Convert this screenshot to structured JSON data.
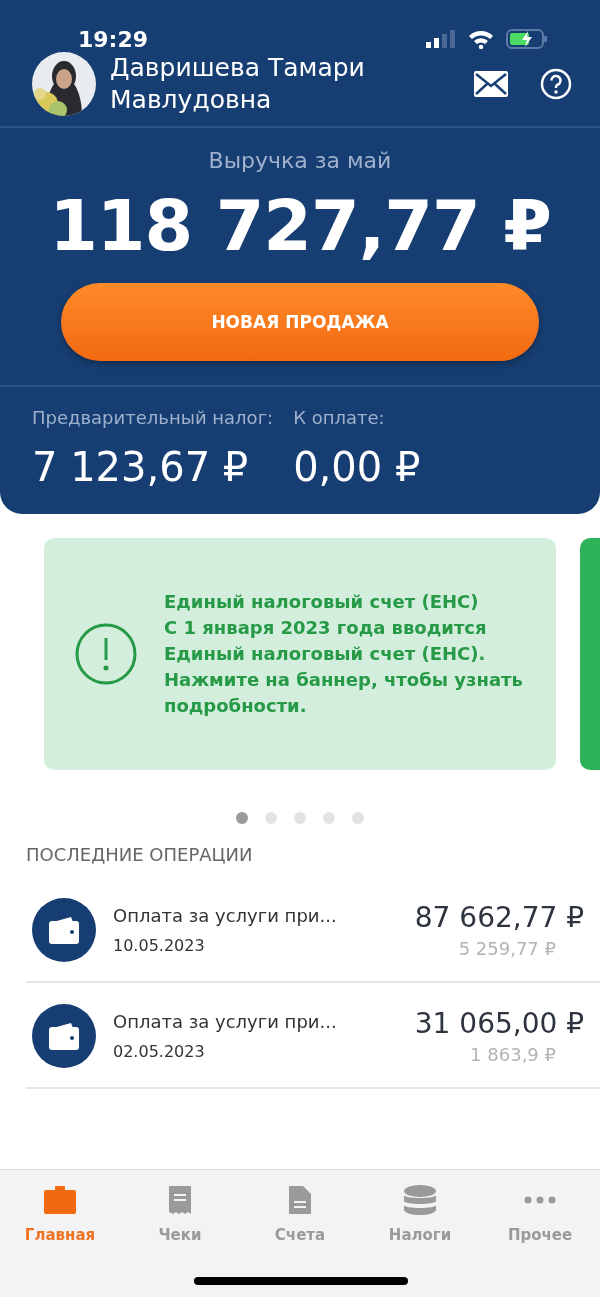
{
  "status_bar": {
    "time": "19:29"
  },
  "profile": {
    "name": "Давришева Тамари Мавлудовна"
  },
  "revenue": {
    "label": "Выручка за май",
    "amount": "118 727,77 ₽"
  },
  "new_sale_button": "НОВАЯ ПРОДАЖА",
  "taxes": [
    {
      "label": "Предварительный налог:",
      "value": "7 123,67 ₽"
    },
    {
      "label": "К оплате:",
      "value": "0,00 ₽"
    }
  ],
  "banner": {
    "title": "Единый налоговый счет (ЕНС)",
    "text": "С 1 января 2023 года вводится Единый налоговый счет (ЕНС). Нажмите на баннер, чтобы узнать подробности."
  },
  "carousel_dots": [
    {
      "selected": true
    },
    {
      "selected": false
    },
    {
      "selected": false
    },
    {
      "selected": false
    },
    {
      "selected": false
    }
  ],
  "operations": {
    "title": "ПОСЛЕДНИЕ ОПЕРАЦИИ",
    "items": [
      {
        "title": "Оплата за услуги при...",
        "date": "10.05.2023",
        "amount": "87 662,77 ₽",
        "tax": "5 259,77 ₽"
      },
      {
        "title": "Оплата за услуги при...",
        "date": "02.05.2023",
        "amount": "31 065,00 ₽",
        "tax": "1 863,9 ₽"
      }
    ]
  },
  "tab_bar": [
    {
      "label": "Главная",
      "kind": "briefcase",
      "selected": true
    },
    {
      "label": "Чеки",
      "kind": "receipt",
      "selected": false
    },
    {
      "label": "Счета",
      "kind": "document",
      "selected": false
    },
    {
      "label": "Налоги",
      "kind": "coins",
      "selected": false
    },
    {
      "label": "Прочее",
      "kind": "more",
      "selected": false
    }
  ]
}
